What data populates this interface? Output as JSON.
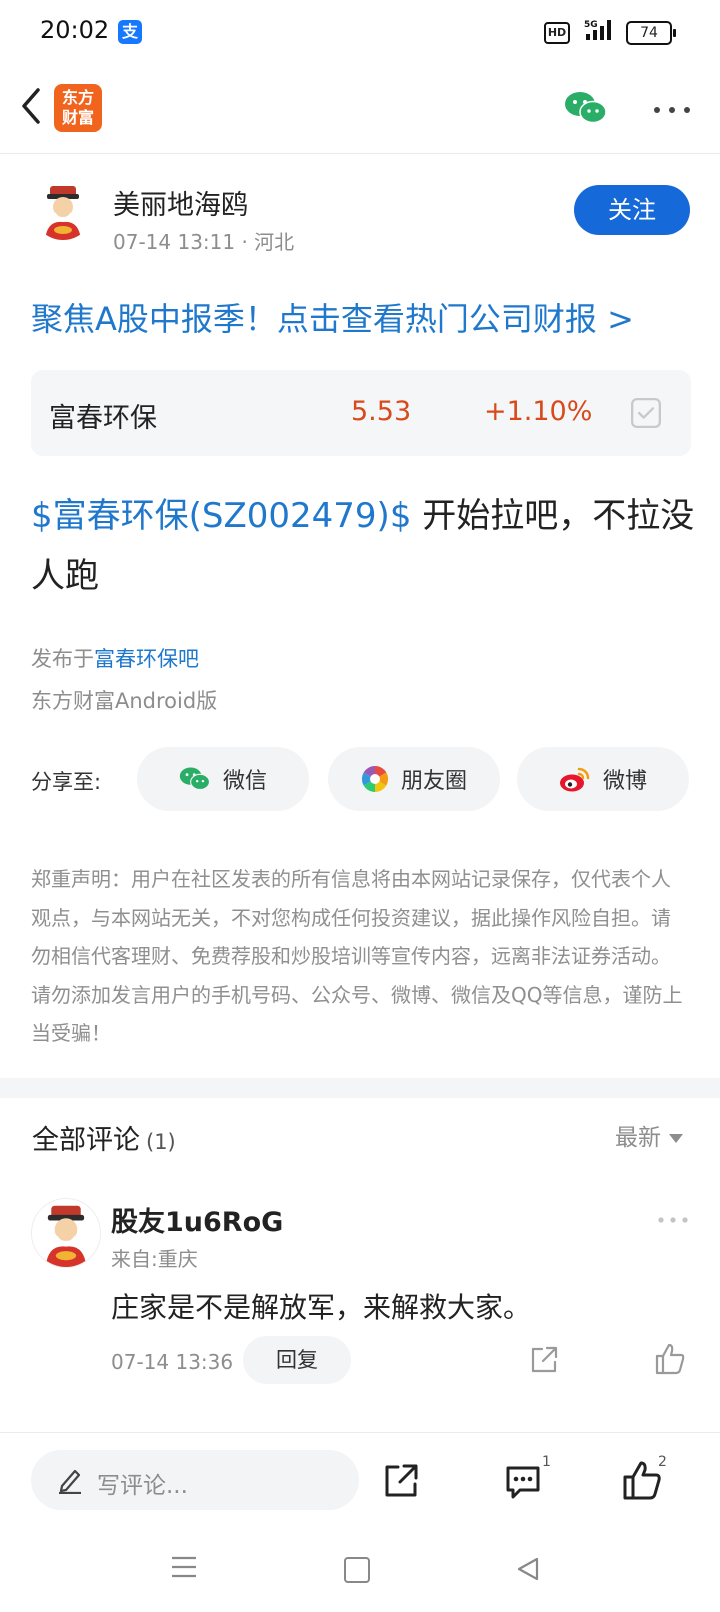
{
  "status_bar": {
    "time": "20:02",
    "alipay_glyph": "支",
    "hd": "HD",
    "network": "5G",
    "battery": "74"
  },
  "nav": {
    "logo_line1": "东方",
    "logo_line2": "财富"
  },
  "post": {
    "author": "美丽地海鸥",
    "meta": "07-14 13:11 · 河北",
    "follow_label": "关注",
    "promo": "聚焦A股中报季！点击查看热门公司财报 >",
    "stock": {
      "name": "富春环保",
      "price": "5.53",
      "change": "+1.10%"
    },
    "tag": "$富春环保(SZ002479)$",
    "text": " 开始拉吧，不拉没人跑",
    "posted_prefix": "发布于",
    "posted_bar": "富春环保吧",
    "client": "东方财富Android版"
  },
  "share": {
    "label": "分享至:",
    "wechat": "微信",
    "moments": "朋友圈",
    "weibo": "微博"
  },
  "disclaimer": "郑重声明：用户在社区发表的所有信息将由本网站记录保存，仅代表个人观点，与本网站无关，不对您构成任何投资建议，据此操作风险自担。请勿相信代客理财、免费荐股和炒股培训等宣传内容，远离非法证券活动。请勿添加发言用户的手机号码、公众号、微博、微信及QQ等信息，谨防上当受骗！",
  "comments": {
    "title": "全部评论",
    "count": "(1)",
    "sort": "最新",
    "items": [
      {
        "user": "股友1u6RoG",
        "from": "来自:重庆",
        "text": "庄家是不是解放军，来解救大家。",
        "time": "07-14 13:36",
        "reply": "回复"
      }
    ]
  },
  "bottom_bar": {
    "placeholder": "写评论...",
    "comment_count": "1",
    "like_count": "2"
  },
  "colors": {
    "accent": "#1f78cc",
    "follow": "#1569d8",
    "up": "#d84a1b",
    "logo": "#f0641e"
  },
  "icons": [
    "back-arrow-icon",
    "wechat-icon",
    "more-icon",
    "check-icon",
    "moments-icon",
    "weibo-icon",
    "share-icon",
    "like-icon",
    "pen-icon",
    "comment-icon"
  ]
}
